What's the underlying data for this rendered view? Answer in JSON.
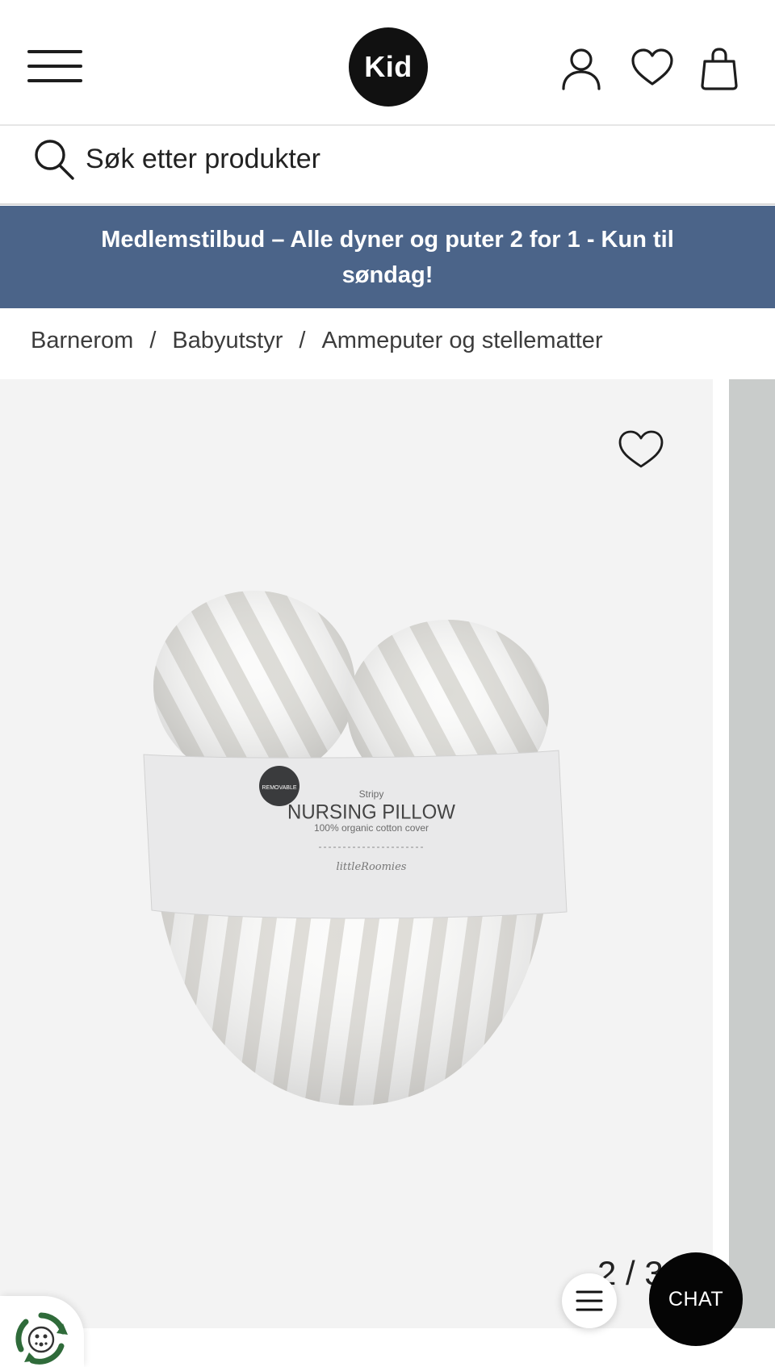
{
  "header": {
    "logo_text": "Kid",
    "icons": [
      "menu-icon",
      "account-icon",
      "wishlist-heart-icon",
      "shopping-bag-icon"
    ]
  },
  "search": {
    "placeholder": "Søk etter produkter"
  },
  "promo": {
    "text": "Medlemstilbud – Alle dyner og puter 2 for 1 - Kun til søndag!",
    "background": "#4b6489"
  },
  "breadcrumb": {
    "items": [
      "Barnerom",
      "Babyutstyr",
      "Ammeputer og stellematter"
    ],
    "separator": "/"
  },
  "gallery": {
    "counter": "2 / 3",
    "product_label": {
      "line1": "Stripy",
      "line2": "NURSING PILLOW",
      "line3": "100% organic cotton cover",
      "brand": "littleRoomies"
    }
  },
  "floating": {
    "chat_label": "CHAT"
  },
  "colors": {
    "promo_bg": "#4b6489",
    "chat_bg": "#050505",
    "eco_green": "#2f6b3a"
  }
}
